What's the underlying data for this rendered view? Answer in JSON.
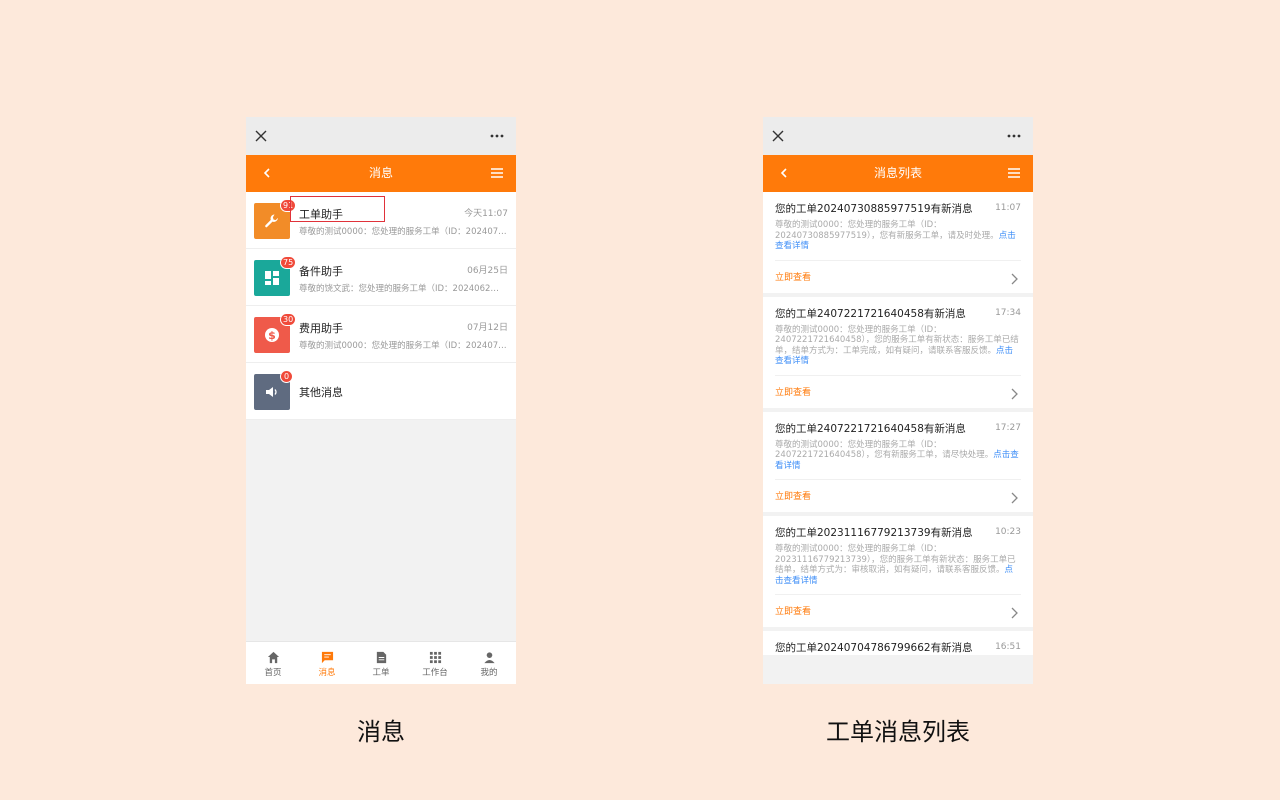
{
  "left": {
    "header_title": "消息",
    "items": [
      {
        "title": "工单助手",
        "time": "今天11:07",
        "preview": "尊敬的测试0000：您处理的服务工单（ID：2024073088…",
        "badge": "91",
        "color": "#f28c28",
        "icon": "wrench-icon"
      },
      {
        "title": "备件助手",
        "time": "06月25日",
        "preview": "尊敬的饶文武：您处理的服务工单（ID：2024062…",
        "badge": "75",
        "color": "#1aa89a",
        "icon": "grid-icon"
      },
      {
        "title": "费用助手",
        "time": "07月12日",
        "preview": "尊敬的测试0000：您处理的服务工单（ID：2024071…",
        "badge": "30",
        "color": "#ef5a4a",
        "icon": "dollar-icon"
      },
      {
        "title": "其他消息",
        "time": "",
        "preview": "",
        "badge": "0",
        "color": "#5f6b80",
        "icon": "speaker-icon"
      }
    ],
    "tabs": [
      {
        "label": "首页",
        "icon": "home-icon"
      },
      {
        "label": "消息",
        "icon": "message-icon",
        "active": true
      },
      {
        "label": "工单",
        "icon": "document-icon"
      },
      {
        "label": "工作台",
        "icon": "apps-grid-icon"
      },
      {
        "label": "我的",
        "icon": "user-icon"
      }
    ]
  },
  "right": {
    "header_title": "消息列表",
    "cards": [
      {
        "title": "您的工单20240730885977519有新消息",
        "time": "11:07",
        "body": "尊敬的测试0000：您处理的服务工单（ID：20240730885977519），您有新服务工单，请及时处理。",
        "link": "点击查看详情",
        "action": "立即查看"
      },
      {
        "title": "您的工单2407221721640458有新消息",
        "time": "17:34",
        "body": "尊敬的测试0000：您处理的服务工单（ID：2407221721640458），您的服务工单有新状态：服务工单已结单，结单方式为：工单完成，如有疑问，请联系客服反馈。",
        "link": "点击查看详情",
        "action": "立即查看"
      },
      {
        "title": "您的工单2407221721640458有新消息",
        "time": "17:27",
        "body": "尊敬的测试0000：您处理的服务工单（ID：2407221721640458），您有新服务工单，请尽快处理。",
        "link": "点击查看详情",
        "action": "立即查看"
      },
      {
        "title": "您的工单20231116779213739有新消息",
        "time": "10:23",
        "body": "尊敬的测试0000：您处理的服务工单（ID：20231116779213739），您的服务工单有新状态：服务工单已结单，结单方式为：审核取消，如有疑问，请联系客服反馈。",
        "link": "点击查看详情",
        "action": "立即查看"
      },
      {
        "title": "您的工单20240704786799662有新消息",
        "time": "16:51",
        "body": "",
        "link": "",
        "action": ""
      }
    ]
  },
  "captions": {
    "left": "消息",
    "right": "工单消息列表"
  }
}
